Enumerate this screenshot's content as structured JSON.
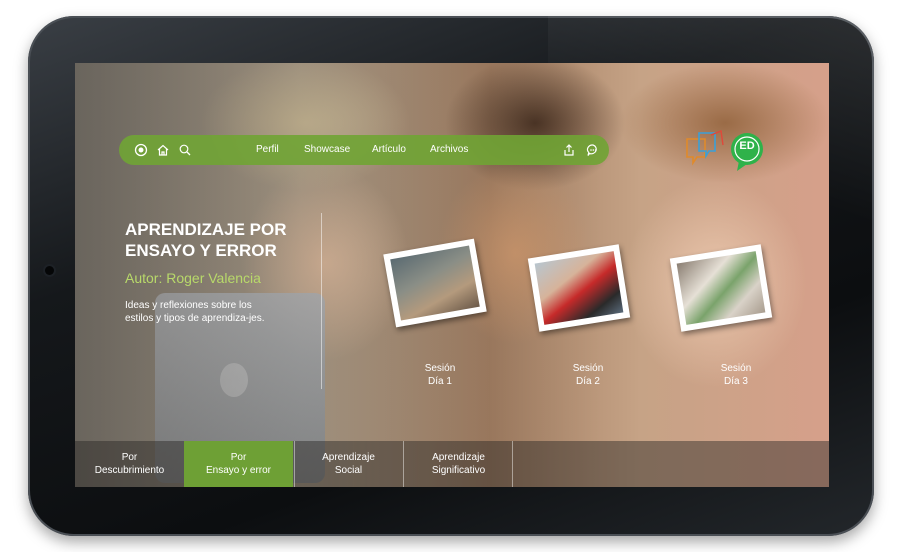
{
  "nav": {
    "items": [
      {
        "label": "Perfil"
      },
      {
        "label": "Showcase"
      },
      {
        "label": "Artículo"
      },
      {
        "label": "Archivos"
      }
    ],
    "icons": [
      "home-icon",
      "search-icon",
      "share-icon",
      "chat-icon"
    ],
    "accent": "#70a434"
  },
  "logo": {
    "text": "ED"
  },
  "hero": {
    "title": "APRENDIZAJE POR ENSAYO Y ERROR",
    "author": "Autor: Roger Valencia",
    "description": "Ideas y reflexiones sobre los estilos y tipos de aprendiza-jes."
  },
  "sessions": [
    {
      "line1": "Sesión",
      "line2": "Día 1"
    },
    {
      "line1": "Sesión",
      "line2": "Día 2"
    },
    {
      "line1": "Sesión",
      "line2": "Día 3"
    }
  ],
  "tabs": [
    {
      "line1": "Por",
      "line2": "Descubrimiento"
    },
    {
      "line1": "Por",
      "line2": "Ensayo y error",
      "active": true
    },
    {
      "line1": "Aprendizaje",
      "line2": "Social"
    },
    {
      "line1": "Aprendizaje",
      "line2": "Significativo"
    }
  ]
}
